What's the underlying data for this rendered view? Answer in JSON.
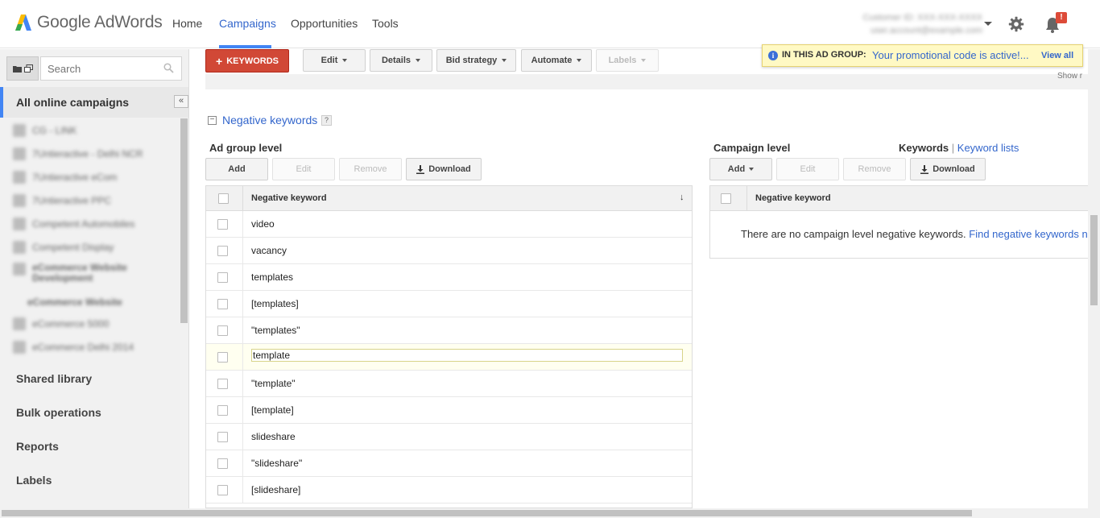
{
  "header": {
    "logo_google": "Google",
    "logo_adwords": "AdWords",
    "nav": [
      "Home",
      "Campaigns",
      "Opportunities",
      "Tools"
    ],
    "active_nav": "Campaigns",
    "notification_badge": "!"
  },
  "notification": {
    "heading": "IN THIS AD GROUP:",
    "message": "Your promotional code is active!...",
    "action": "View all",
    "icon": "info-icon"
  },
  "sidebar": {
    "search_placeholder": "Search",
    "all_campaigns": "All online campaigns",
    "collapse": "«",
    "links": [
      "Shared library",
      "Bulk operations",
      "Reports",
      "Labels"
    ]
  },
  "toolbar": {
    "keywords_button": "KEYWORDS",
    "buttons": [
      "Edit",
      "Details",
      "Bid strategy",
      "Automate",
      "Labels"
    ],
    "show_text": "Show r"
  },
  "negative_keywords": {
    "title": "Negative keywords",
    "help": "?",
    "ad_group": {
      "title": "Ad group level",
      "buttons": {
        "add": "Add",
        "edit": "Edit",
        "remove": "Remove",
        "download": "Download"
      },
      "column": "Negative keyword",
      "sort_indicator": "↓",
      "rows": [
        "video",
        "vacancy",
        "templates",
        "[templates]",
        "\"templates\"",
        "template",
        "\"template\"",
        "[template]",
        "slideshare",
        "\"slideshare\"",
        "[slideshare]"
      ],
      "selected_row_index": 5
    },
    "campaign": {
      "title": "Campaign level",
      "keywords_label": "Keywords",
      "separator": "|",
      "keyword_lists_link": "Keyword lists",
      "buttons": {
        "add": "Add",
        "edit": "Edit",
        "remove": "Remove",
        "download": "Download"
      },
      "column": "Negative keyword",
      "empty_message": "There are no campaign level negative keywords.",
      "empty_link": "Find negative keywords n"
    }
  },
  "colors": {
    "brand_blue": "#3366cc",
    "accent_blue": "#4285f4",
    "keywords_red": "#d14836",
    "notification_bg": "#fff9c4"
  }
}
